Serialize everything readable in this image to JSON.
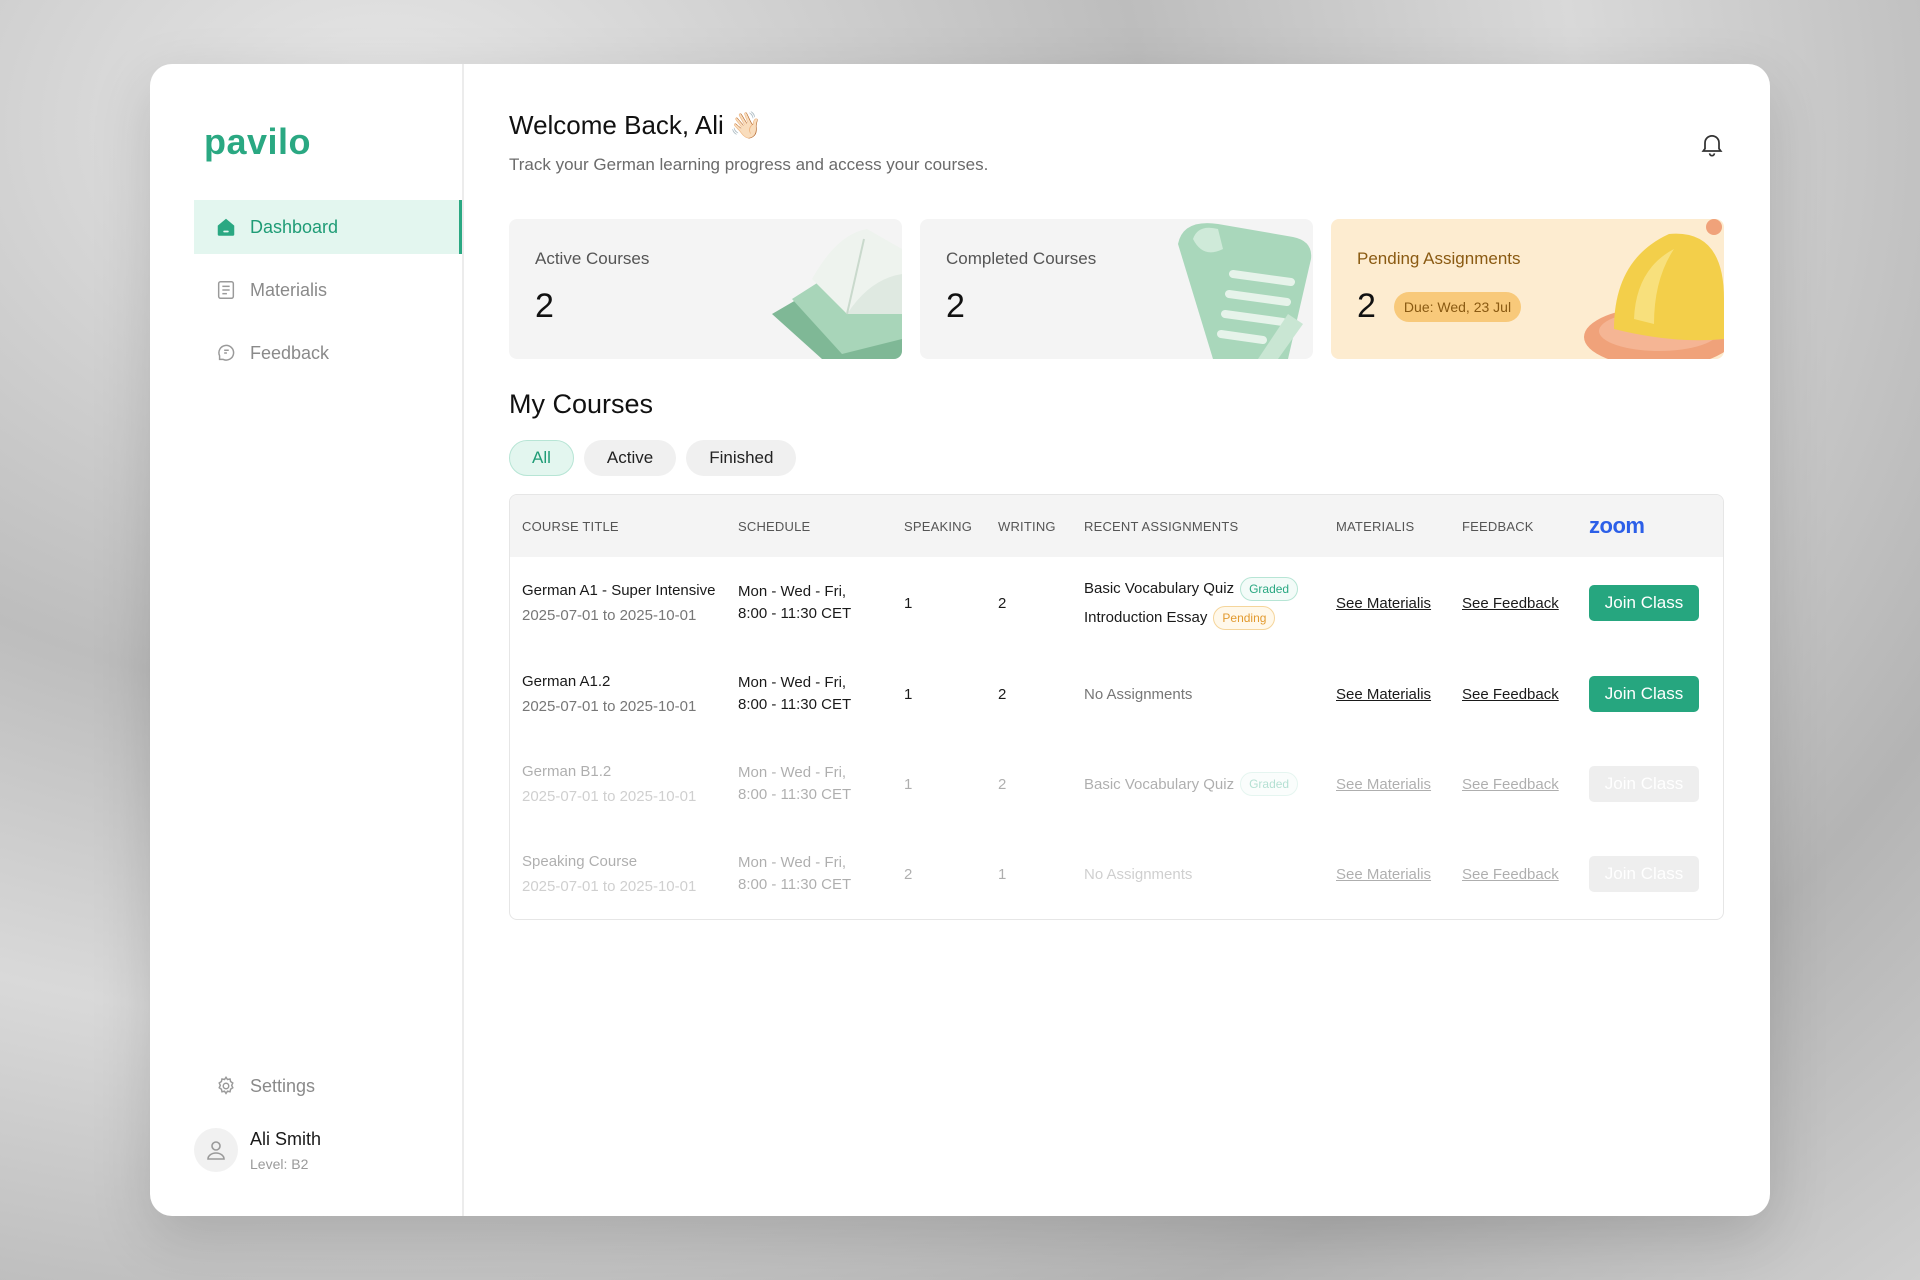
{
  "brand": {
    "name": "pavilo",
    "color": "#2aa882"
  },
  "sidebar": {
    "items": [
      {
        "label": "Dashboard",
        "icon": "home-icon",
        "active": true
      },
      {
        "label": "Materialis",
        "icon": "document-icon",
        "active": false
      },
      {
        "label": "Feedback",
        "icon": "feedback-icon",
        "active": false
      }
    ],
    "settings_label": "Settings",
    "user": {
      "name": "Ali Smith",
      "level": "Level: B2"
    }
  },
  "header": {
    "welcome": "Welcome Back, Ali",
    "wave": "👋🏻",
    "subtitle": "Track your German learning progress and access your courses."
  },
  "stats": {
    "active": {
      "label": "Active Courses",
      "value": "2"
    },
    "completed": {
      "label": "Completed Courses",
      "value": "2"
    },
    "pending": {
      "label": "Pending Assignments",
      "value": "2",
      "due": "Due: Wed, 23 Jul"
    }
  },
  "courses": {
    "title": "My Courses",
    "filters": [
      "All",
      "Active",
      "Finished"
    ],
    "columns": [
      "COURSE TITLE",
      "SCHEDULE",
      "SPEAKING",
      "WRITING",
      "RECENT ASSIGNMENTS",
      "MATERIALIS",
      "FEEDBACK"
    ],
    "zoom_label": "zoom",
    "rows": [
      {
        "title": "German A1 - Super Intensive",
        "dates": "2025-07-01 to 2025-10-01",
        "schedule_1": "Mon - Wed - Fri,",
        "schedule_2": "8:00 - 11:30 CET",
        "speaking": "1",
        "writing": "2",
        "assignment_1": "Basic Vocabulary Quiz",
        "tag_1": "Graded",
        "assignment_2": "Introduction Essay",
        "tag_2": "Pending",
        "materials": "See Materialis",
        "feedback": "See Feedback",
        "join": "Join Class"
      },
      {
        "title": "German A1.2",
        "dates": "2025-07-01 to 2025-10-01",
        "schedule_1": "Mon - Wed - Fri,",
        "schedule_2": "8:00 - 11:30 CET",
        "speaking": "1",
        "writing": "2",
        "assignment_1": "No Assignments",
        "materials": "See Materialis",
        "feedback": "See Feedback",
        "join": "Join Class"
      },
      {
        "title": "German B1.2",
        "dates": "2025-07-01 to 2025-10-01",
        "schedule_1": "Mon - Wed - Fri,",
        "schedule_2": "8:00 - 11:30 CET",
        "speaking": "1",
        "writing": "2",
        "assignment_1": "Basic Vocabulary Quiz",
        "tag_1": "Graded",
        "materials": "See Materialis",
        "feedback": "See Feedback",
        "join": "Join Class"
      },
      {
        "title": "Speaking Course",
        "dates": "2025-07-01 to 2025-10-01",
        "schedule_1": "Mon - Wed - Fri,",
        "schedule_2": "8:00 - 11:30 CET",
        "speaking": "2",
        "writing": "1",
        "assignment_1": "No Assignments",
        "materials": "See Materialis",
        "feedback": "See Feedback",
        "join": "Join Class"
      }
    ]
  }
}
